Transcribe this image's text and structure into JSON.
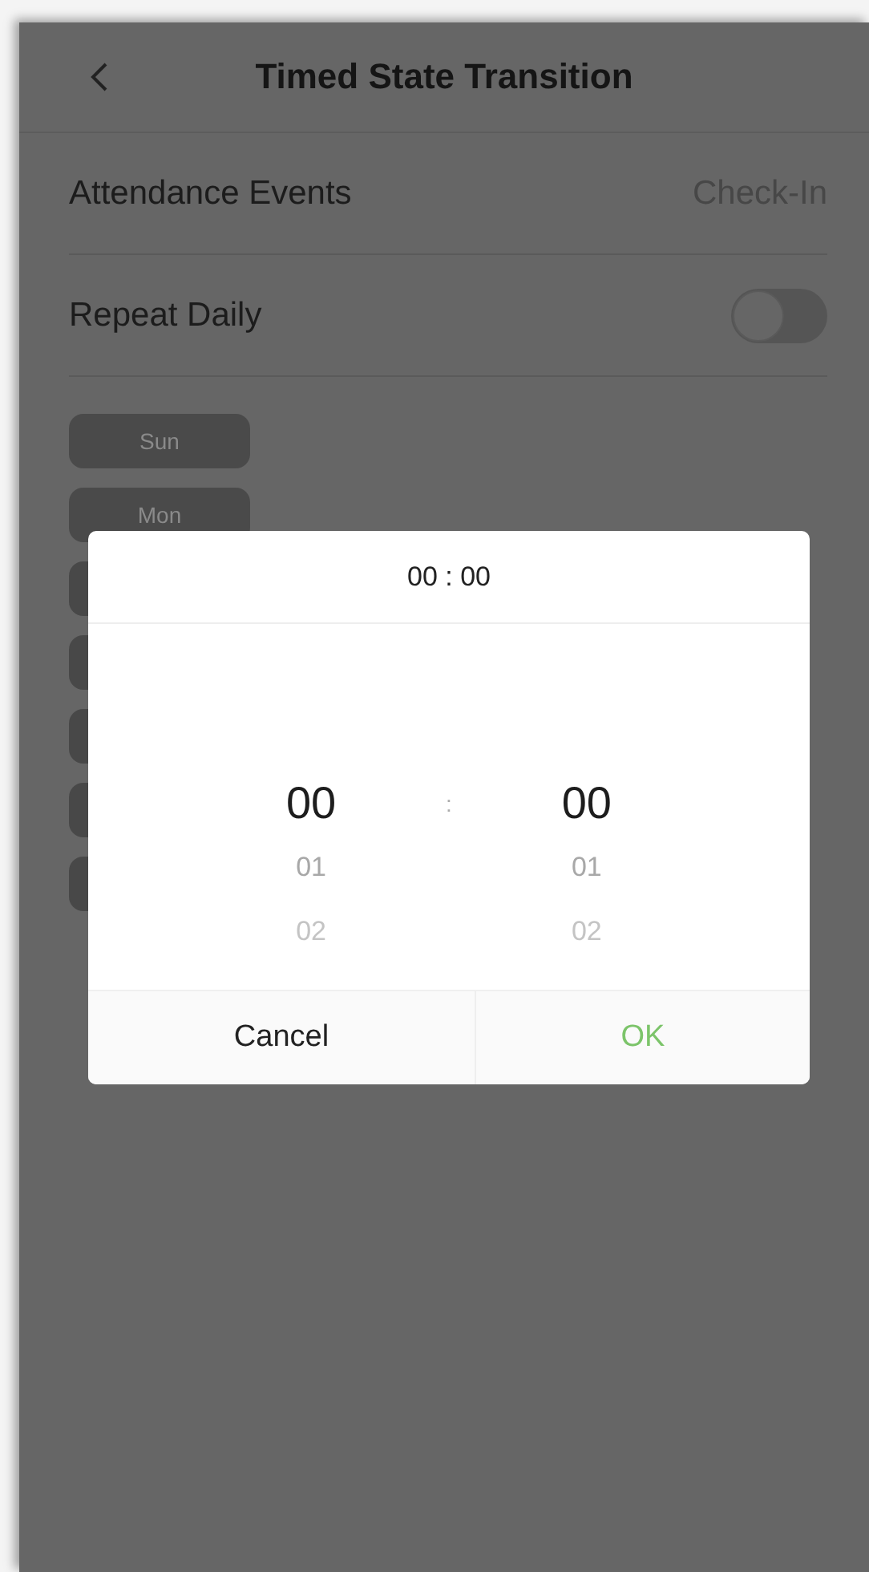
{
  "header": {
    "title": "Timed State Transition"
  },
  "settings": [
    {
      "kind": "value",
      "label": "Attendance Events",
      "value": "Check-In"
    },
    {
      "kind": "toggle",
      "label": "Repeat Daily",
      "on": false
    }
  ],
  "days": [
    {
      "label": "Sun"
    },
    {
      "label": "Mon"
    }
  ],
  "dialog": {
    "title": "00 : 00",
    "separator": ":",
    "columns": [
      {
        "items": [
          {
            "text": "00",
            "selected": true
          },
          {
            "text": "01",
            "selected": false
          },
          {
            "text": "02",
            "selected": false
          }
        ]
      },
      {
        "items": [
          {
            "text": "00",
            "selected": true
          },
          {
            "text": "01",
            "selected": false
          },
          {
            "text": "02",
            "selected": false
          }
        ]
      }
    ],
    "buttons": [
      {
        "label": "Cancel",
        "kind": "cancel"
      },
      {
        "label": "OK",
        "kind": "confirm"
      }
    ]
  }
}
